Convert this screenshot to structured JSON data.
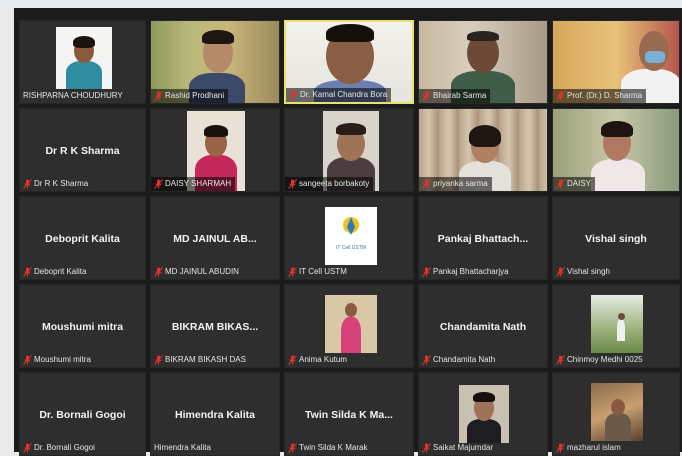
{
  "participants": [
    {
      "label": "RISHPARNA CHOUDHURY"
    },
    {
      "label": "Rashid Prodhani"
    },
    {
      "label": "Dr. Kamal Chandra Bora"
    },
    {
      "label": "Bhairab Sarma"
    },
    {
      "label": "Prof. (Dr.) D. Sharma"
    },
    {
      "label": "Dr R K Sharma",
      "display": "Dr R K Sharma"
    },
    {
      "label": "DAISY SHARMAH"
    },
    {
      "label": "sangeeta borbakoty"
    },
    {
      "label": "priyanka sarma"
    },
    {
      "label": "DAISY"
    },
    {
      "label": "Deboprit Kalita",
      "display": "Deboprit Kalita"
    },
    {
      "label": "MD JAINUL ABUDIN",
      "display": "MD JAINUL AB..."
    },
    {
      "label": "IT Cell USTM",
      "logo_text": "IT Cell USTM"
    },
    {
      "label": "Pankaj Bhattacharjya",
      "display": "Pankaj  Bhattach..."
    },
    {
      "label": "Vishal singh",
      "display": "Vishal singh"
    },
    {
      "label": "Moushumi mitra",
      "display": "Moushumi mitra"
    },
    {
      "label": "BIKRAM BIKASH DAS",
      "display": "BIKRAM BIKAS..."
    },
    {
      "label": "Anima Kutum"
    },
    {
      "label": "Chandamita Nath",
      "display": "Chandamita Nath"
    },
    {
      "label": "Chinmoy Medhi 0025"
    },
    {
      "label": "Dr. Bornali Gogoi",
      "display": "Dr. Bornali Gogoi"
    },
    {
      "label": "Himendra Kalita",
      "display": "Himendra Kalita"
    },
    {
      "label": "Twin Silda K Marak",
      "display": "Twin Silda  K  Ma..."
    },
    {
      "label": "Saikat Majumdar"
    },
    {
      "label": "mazharul islam"
    }
  ],
  "colors": {
    "muted_mic": "#e0332b",
    "active_border": "#e8e26a",
    "tile_bg": "#2e2e2e"
  }
}
